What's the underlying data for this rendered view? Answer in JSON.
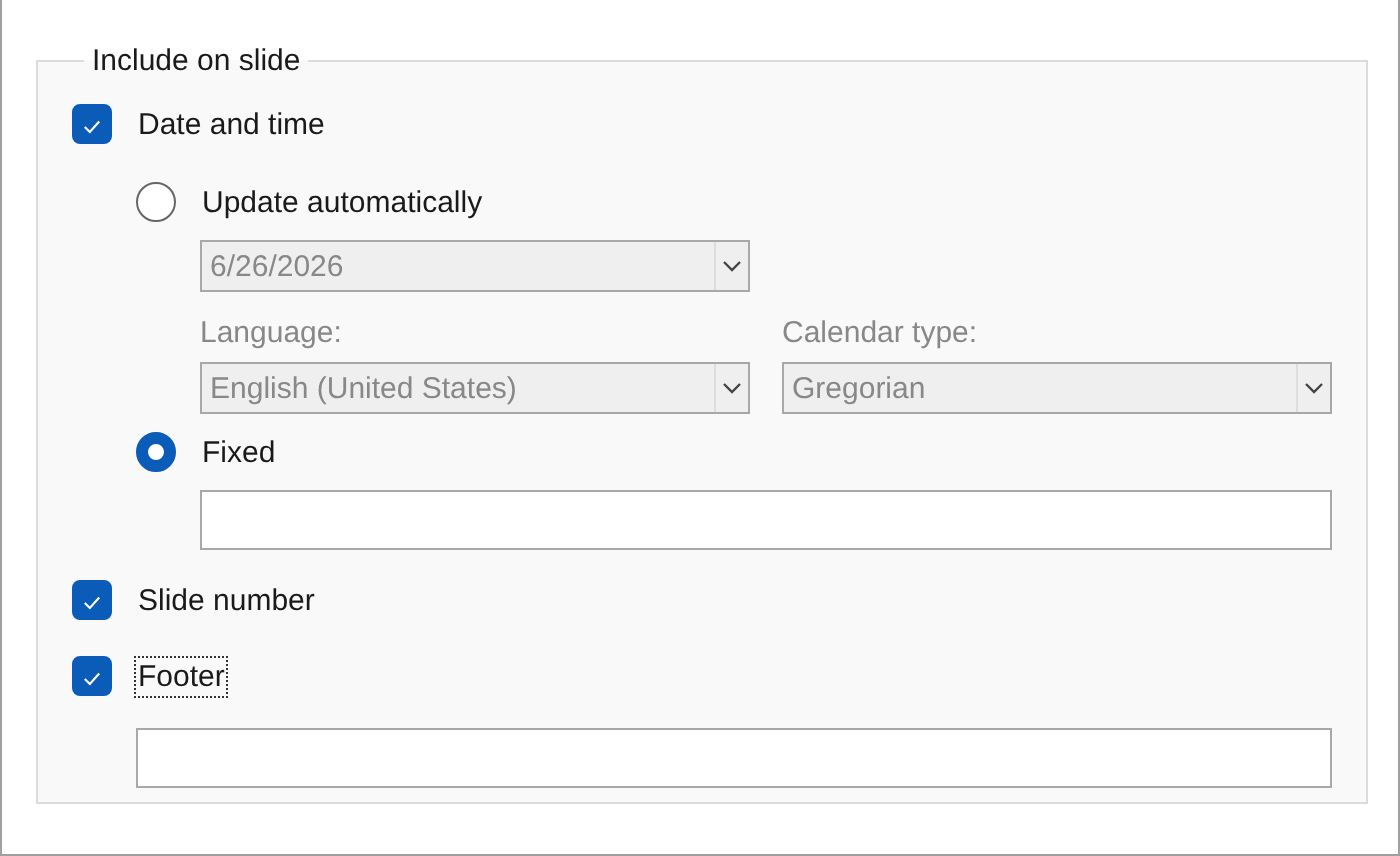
{
  "group": {
    "title": "Include on slide"
  },
  "date_time": {
    "label": "Date and time",
    "checked": true,
    "options": [
      {
        "label": "Update automatically",
        "selected": false
      },
      {
        "label": "Fixed",
        "selected": true
      }
    ],
    "date_dropdown": {
      "value": "6/26/2026",
      "disabled": true
    },
    "language": {
      "label": "Language:",
      "value": "English (United States)",
      "disabled": true
    },
    "calendar_type": {
      "label": "Calendar type:",
      "value": "Gregorian",
      "disabled": true
    }
  },
  "slide_number": {
    "label": "Slide number",
    "checked": true
  },
  "footer": {
    "label": "Footer",
    "checked": true,
    "focused": true
  }
}
